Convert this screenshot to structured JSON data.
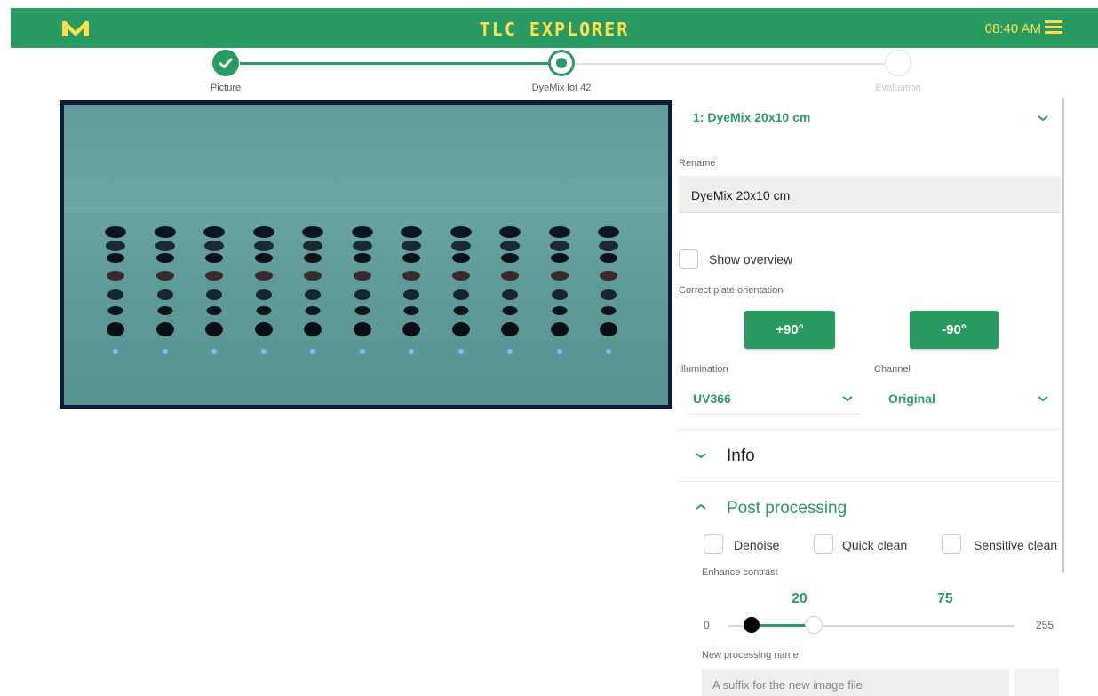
{
  "header": {
    "title": "TLC EXPLORER",
    "time": "08:40 AM",
    "logo_icon": "merck-m-logo",
    "menu_icon": "hamburger-menu-icon",
    "bar_color": "#2a9a63",
    "accent_color": "#ffe04a"
  },
  "stepper": {
    "steps": [
      {
        "label": "Picture",
        "state": "completed"
      },
      {
        "label": "DyeMix lot 42",
        "state": "active"
      },
      {
        "label": "Evaluation",
        "state": "pending"
      }
    ]
  },
  "plate": {
    "lanes": 11,
    "illumination_color": "#6aa6a2"
  },
  "panel": {
    "plate_select": "1: DyeMix 20x10 cm",
    "rename_label": "Rename",
    "rename_value": "DyeMix 20x10 cm",
    "show_overview_label": "Show overview",
    "show_overview_checked": false,
    "orientation_label": "Correct plate orientation",
    "rotate_plus_label": "+90°",
    "rotate_minus_label": "-90°",
    "illumination_label": "Illumination",
    "illumination_value": "UV366",
    "channel_label": "Channel",
    "channel_value": "Original",
    "info_section": "Info",
    "post_processing_section": "Post processing",
    "denoise_label": "Denoise",
    "quick_clean_label": "Quick clean",
    "sensitive_clean_label": "Sensitive clean",
    "enhance_contrast_label": "Enhance contrast",
    "contrast_low": "20",
    "contrast_high": "75",
    "range_min": "0",
    "range_max": "255",
    "new_processing_label": "New processing name",
    "suffix_placeholder": "A suffix for the new image file"
  }
}
